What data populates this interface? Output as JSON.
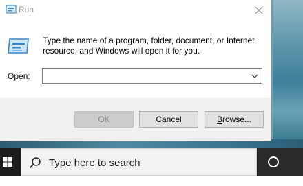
{
  "window": {
    "title": "Run",
    "close_symbol": "✕"
  },
  "dialog": {
    "description": "Type the name of a program, folder, document, or Internet resource, and Windows will open it for you.",
    "open_label_mnemonic": "O",
    "open_label_rest": "pen:",
    "open_value": ""
  },
  "buttons": {
    "ok": "OK",
    "cancel": "Cancel",
    "browse_mnemonic": "B",
    "browse_rest": "rowse..."
  },
  "taskbar": {
    "search_placeholder": "Type here to search"
  },
  "icons": {
    "title": "run-icon",
    "close": "close-icon",
    "dropdown": "chevron-down-icon",
    "start": "windows-logo-icon",
    "search": "search-icon",
    "cortana": "cortana-icon"
  },
  "colors": {
    "window_bg": "#ffffff",
    "footer_bg": "#f0f0f0",
    "taskbar_bg": "#1c1c1c",
    "button_bg": "#e1e1e1",
    "disabled_text": "#838383"
  }
}
